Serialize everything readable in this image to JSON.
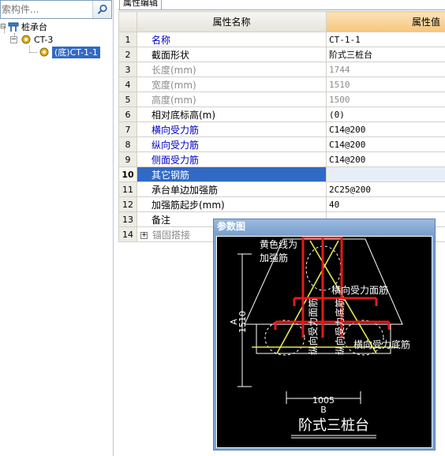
{
  "search": {
    "placeholder": "索构件..."
  },
  "tree": {
    "root": "桩承台",
    "child": "CT-3",
    "leaf": "(底)CT-1-1"
  },
  "tab": {
    "label": "属性编辑"
  },
  "grid": {
    "header_name": "属性名称",
    "header_value": "属性值",
    "rows": [
      {
        "num": "1",
        "name": "名称",
        "value": "CT-1-1"
      },
      {
        "num": "2",
        "name": "截面形状",
        "value": "阶式三桩台"
      },
      {
        "num": "3",
        "name": "长度(mm)",
        "value": "1744"
      },
      {
        "num": "4",
        "name": "宽度(mm)",
        "value": "1510"
      },
      {
        "num": "5",
        "name": "高度(mm)",
        "value": "1500"
      },
      {
        "num": "6",
        "name": "相对底标高(m)",
        "value": "(0)"
      },
      {
        "num": "7",
        "name": "横向受力筋",
        "value": "C14@200"
      },
      {
        "num": "8",
        "name": "纵向受力筋",
        "value": "C14@200"
      },
      {
        "num": "9",
        "name": "侧面受力筋",
        "value": "C14@200"
      },
      {
        "num": "10",
        "name": "其它钢筋",
        "value": ""
      },
      {
        "num": "11",
        "name": "承台单边加强筋",
        "value": "2C25@200"
      },
      {
        "num": "12",
        "name": "加强筋起步(mm)",
        "value": "40"
      },
      {
        "num": "13",
        "name": "备注",
        "value": ""
      },
      {
        "num": "14",
        "name": "锚固搭接",
        "value": ""
      }
    ]
  },
  "param": {
    "title": "参数图",
    "note_line1": "黄色线为",
    "note_line2": "加强筋",
    "label_transverse_top": "横向受力面筋",
    "label_transverse_bottom": "横向受力底筋",
    "label_long_top": "纵向受力面筋",
    "label_long_bottom": "纵向受力底筋",
    "dim_a_letter": "A",
    "dim_a_value": "1510",
    "dim_b_value": "1005",
    "dim_b_letter": "B",
    "caption": "阶式三桩台"
  },
  "colors": {
    "selection": "#316ac5",
    "header_value_bg": "#f4c67e",
    "rebar_red": "#e11b1b",
    "strengthen_yellow": "#e8e84a"
  }
}
